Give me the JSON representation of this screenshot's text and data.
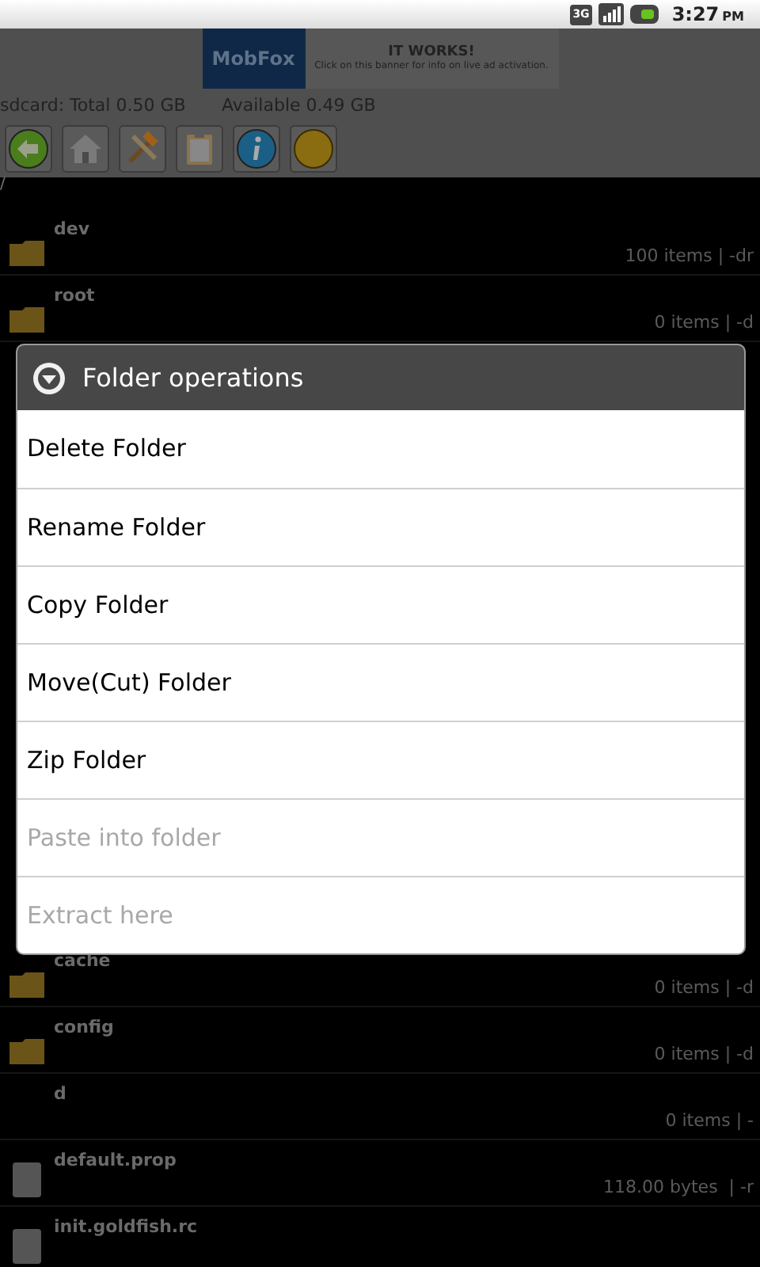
{
  "status_bar": {
    "network": "3G",
    "time": "3:27",
    "meridiem": "PM"
  },
  "ad": {
    "logo": "MobFox",
    "headline": "IT WORKS!",
    "text": "Click on this banner for info on live ad activation."
  },
  "storage": {
    "total": "sdcard: Total 0.50 GB",
    "available": "Available 0.49 GB"
  },
  "toolbar": [
    {
      "kind": "back"
    },
    {
      "kind": "home"
    },
    {
      "kind": "tools"
    },
    {
      "kind": "clipboard"
    },
    {
      "kind": "info"
    },
    {
      "kind": "circle"
    }
  ],
  "path": "/",
  "rows_above": [
    {
      "name": "dev",
      "meta": "100 items | -dr",
      "kind": "folder"
    },
    {
      "name": "root",
      "meta": "0 items | -d",
      "kind": "folder"
    }
  ],
  "rows_below": [
    {
      "name": "cache",
      "meta": "0 items | -d",
      "kind": "folder"
    },
    {
      "name": "config",
      "meta": "0 items | -d",
      "kind": "folder"
    },
    {
      "name": "d",
      "meta": "0 items | -",
      "kind": "none"
    },
    {
      "name": "default.prop",
      "meta": "118.00 bytes  | -r",
      "kind": "file"
    },
    {
      "name": "init.goldfish.rc",
      "kind": "file"
    }
  ],
  "dialog": {
    "title": "Folder operations",
    "items": [
      {
        "label": "Delete Folder",
        "disabled": false
      },
      {
        "label": "Rename Folder",
        "disabled": false
      },
      {
        "label": "Copy Folder",
        "disabled": false
      },
      {
        "label": "Move(Cut) Folder",
        "disabled": false
      },
      {
        "label": "Zip Folder",
        "disabled": false
      },
      {
        "label": "Paste into folder",
        "disabled": true
      },
      {
        "label": "Extract here",
        "disabled": true
      }
    ]
  }
}
